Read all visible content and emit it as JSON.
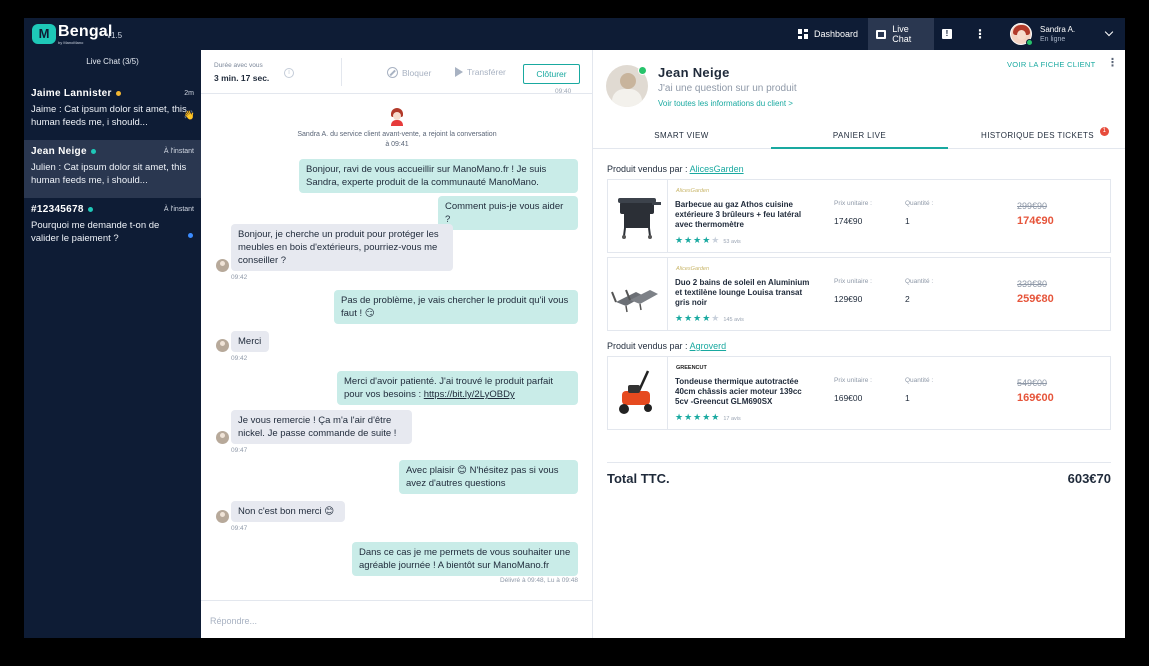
{
  "app": {
    "brand": "Bengal",
    "brand_sub": "by ManoMano",
    "version": "v1.5",
    "logo_letter": "M"
  },
  "topbar": {
    "dashboard_label": "Dashboard",
    "livechat_label": "Live Chat",
    "user_name": "Sandra A.",
    "user_status": "En ligne"
  },
  "sidebar": {
    "title": "Live Chat (3/5)",
    "conversations": [
      {
        "name": "Jaime Lannister",
        "time": "2m",
        "preview": "Jaime : Cat ipsum dolor sit amet, this human feeds me, i should...",
        "status_color": "#f2b632",
        "emoji": "👋"
      },
      {
        "name": "Jean Neige",
        "time": "À l'instant",
        "preview": "Julien : Cat ipsum dolor sit amet, this human feeds me, i should...",
        "status_color": "#1ec8b8"
      },
      {
        "name": "#12345678",
        "time": "À l'instant",
        "preview": "Pourquoi me demande t-on de valider le paiement ?",
        "status_color": "#1ec8b8"
      }
    ]
  },
  "chat": {
    "duration_label": "Durée avec vous",
    "duration_value": "3 min. 17 sec.",
    "block_label": "Bloquer",
    "transfer_label": "Transférer",
    "close_label": "Clôturer",
    "top_time": "09:40",
    "agent_join": "Sandra A. du service client avant-vente, a rejoint la conversation à 09:41",
    "messages": [
      {
        "text": "Bonjour, ravi de vous accueillir sur ManoMano.fr ! Je suis Sandra, experte produit de la communauté ManoMano."
      },
      {
        "text": "Comment puis-je vous aider ?"
      },
      {
        "text": "Bonjour, je cherche un produit pour protéger les meubles en bois d'extérieurs, pourriez-vous me conseiller ?",
        "time": "09:42"
      },
      {
        "text": "Pas de problème, je vais chercher le produit qu'il vous faut ! 😏"
      },
      {
        "text": "Merci",
        "time": "09:42"
      },
      {
        "text": "Merci d'avoir patienté. J'ai trouvé le produit parfait pour vos besoins :",
        "link": "https://bit.ly/2LyOBDy"
      },
      {
        "text": "Je vous remercie ! Ça m'a l'air d'être nickel. Je passe commande de suite !",
        "time": "09:47"
      },
      {
        "text": "Avec plaisir 😊 N'hésitez pas si vous avez d'autres questions"
      },
      {
        "text": "Non c'est bon merci 😊",
        "time": "09:47"
      },
      {
        "text": "Dans ce cas je me permets de vous souhaiter une agréable journée ! A bientôt sur ManoMano.fr"
      }
    ],
    "delivery": "Délivré à 09:48, Lu à 09:48",
    "reply_placeholder": "Répondre..."
  },
  "panel": {
    "client_name": "Jean Neige",
    "client_sub": "J'ai une question sur un produit",
    "client_link": "Voir toutes les informations du client >",
    "client_sheet": "VOIR LA FICHE CLIENT",
    "tabs": [
      "SMART VIEW",
      "PANIER LIVE",
      "HISTORIQUE DES TICKETS"
    ],
    "tickets_badge": "1",
    "seller_prefix": "Produit vendus par :",
    "sellers": [
      "AlicesGarden",
      "Agroverd"
    ],
    "unit_price_label": "Prix unitaire :",
    "qty_label": "Quantité :",
    "products": [
      {
        "brand": "AlicesGarden",
        "title": "Barbecue au gaz Athos cuisine extérieure 3 brûleurs + feu latéral avec thermomètre",
        "rating": 4,
        "reviews": "53 avis",
        "unit_price": "174€90",
        "qty": "1",
        "old_price": "299€90",
        "new_price": "174€90"
      },
      {
        "brand": "AlicesGarden",
        "title": "Duo 2 bains de soleil en Aluminium et textilène lounge Louisa transat gris noir",
        "rating": 4,
        "reviews": "145 avis",
        "unit_price": "129€90",
        "qty": "2",
        "old_price": "339€80",
        "new_price": "259€80"
      },
      {
        "brand": "GREENCUT",
        "title": "Tondeuse thermique autotractée 40cm châssis acier moteur 139cc 5cv -Greencut GLM690SX",
        "rating": 5,
        "reviews": "17 avis",
        "unit_price": "169€00",
        "qty": "1",
        "old_price": "549€00",
        "new_price": "169€00"
      }
    ],
    "total_label": "Total TTC.",
    "total_value": "603€70"
  },
  "colors": {
    "navy": "#0e1c35",
    "teal": "#19a9a0",
    "outgoing_bubble": "#c9ece8",
    "incoming_bubble": "#e7e9f0",
    "sale_price": "#e6553b"
  }
}
